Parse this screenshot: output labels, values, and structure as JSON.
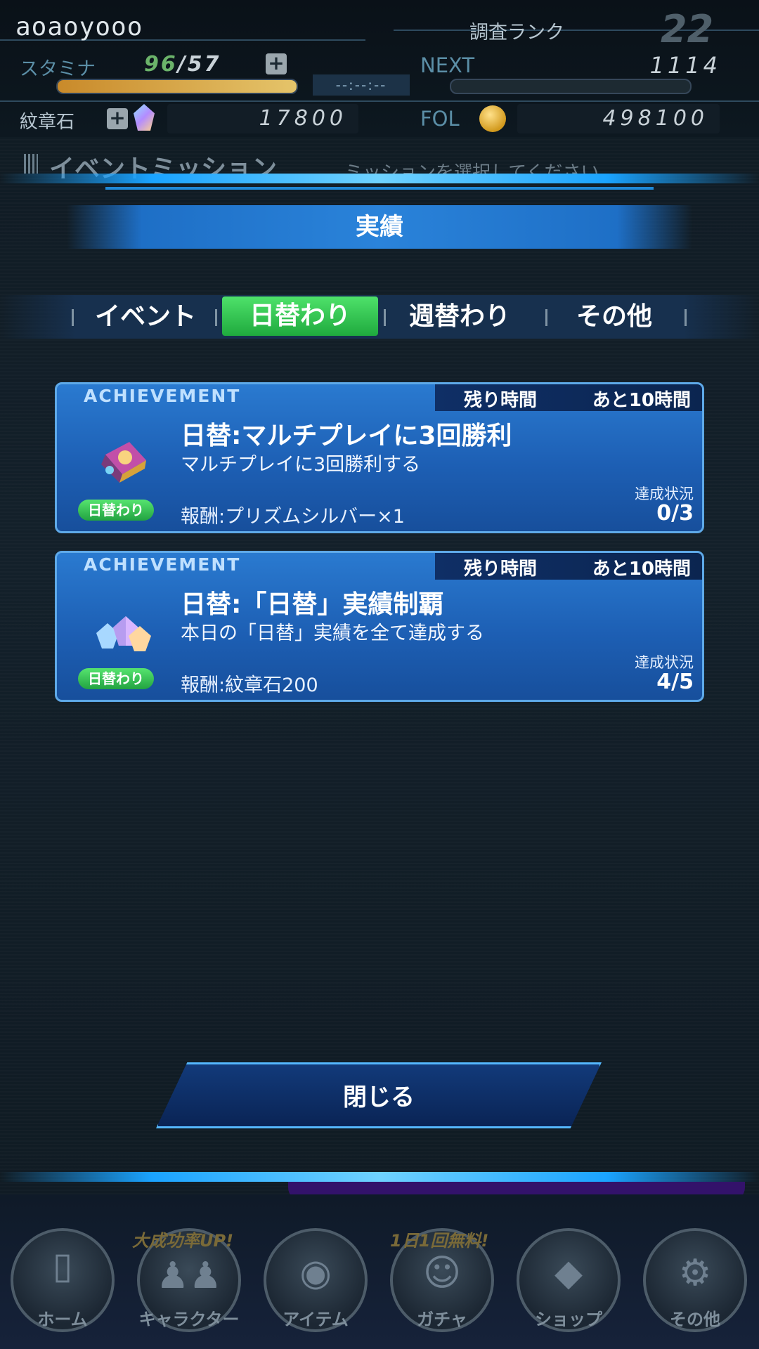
{
  "header": {
    "username": "aoaoyooo",
    "rank_label": "調査ランク",
    "rank_value": "22",
    "stamina_label": "スタミナ",
    "stamina_current": "96",
    "stamina_sep": "/",
    "stamina_max": "57",
    "stamina_fill_fraction": 1.0,
    "timer": "--:--:--",
    "next_label": "NEXT",
    "next_value": "1114",
    "next_fill_fraction": 0.0,
    "crest_label": "紋章石",
    "crest_value": "17800",
    "fol_label": "FOL",
    "fol_value": "498100",
    "plus": "+"
  },
  "underlying": {
    "screen_title": "イベントミッション",
    "hint": "ミッションを選択してください。"
  },
  "modal": {
    "title": "実績",
    "tabs": [
      {
        "label": "イベント",
        "active": false
      },
      {
        "label": "日替わり",
        "active": true
      },
      {
        "label": "週替わり",
        "active": false
      },
      {
        "label": "その他",
        "active": false
      }
    ],
    "missions": [
      {
        "header": "ACHIEVEMENT",
        "remain_label": "残り時間",
        "remain_value": "あと10時間",
        "title": "日替:マルチプレイに3回勝利",
        "description": "マルチプレイに3回勝利する",
        "badge": "日替わり",
        "reward": "報酬:プリズムシルバー×1",
        "status_label": "達成状況",
        "status_value": "0/3",
        "icon": "prism-cube-icon"
      },
      {
        "header": "ACHIEVEMENT",
        "remain_label": "残り時間",
        "remain_value": "あと10時間",
        "title": "日替:「日替」実績制覇",
        "description": "本日の「日替」実績を全て達成する",
        "badge": "日替わり",
        "reward": "報酬:紋章石200",
        "status_label": "達成状況",
        "status_value": "4/5",
        "icon": "crest-gems-icon"
      }
    ],
    "close_label": "閉じる"
  },
  "nav": {
    "items": [
      {
        "label": "ホーム",
        "icon": "door-icon"
      },
      {
        "label": "キャラクター",
        "icon": "characters-icon",
        "promo": "大成功率UP!"
      },
      {
        "label": "アイテム",
        "icon": "bag-icon"
      },
      {
        "label": "ガチャ",
        "icon": "gacha-icon",
        "promo": "1日1回無料!"
      },
      {
        "label": "ショップ",
        "icon": "crystal-icon"
      },
      {
        "label": "その他",
        "icon": "gear-icon"
      }
    ]
  }
}
